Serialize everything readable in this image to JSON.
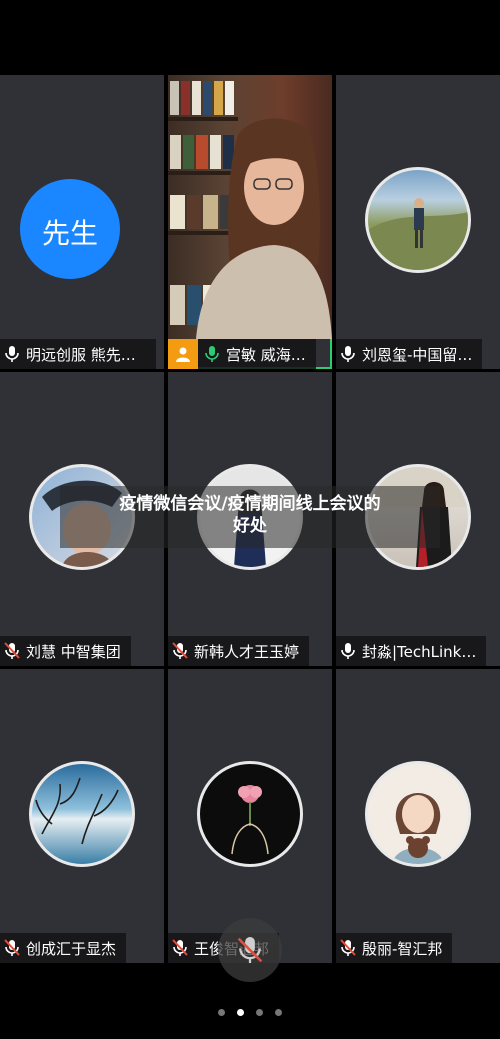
{
  "meeting": {
    "title_line1": "疫情微信会议/疫情期间线上会议的",
    "title_line2": "好处"
  },
  "participants": [
    {
      "name": "明远创服  熊先生…",
      "avatar_text": "先生",
      "mic": "on",
      "avatar": "blue-text"
    },
    {
      "name": "宫敏 威海…",
      "mic": "on",
      "host": true,
      "video": true
    },
    {
      "name": "刘恩玺-中国留…",
      "mic": "on",
      "avatar": "photo-hiker"
    },
    {
      "name": "刘慧 中智集团",
      "mic": "muted",
      "avatar": "photo-woman-hat"
    },
    {
      "name": "新韩人才王玉婷",
      "mic": "muted",
      "avatar": "photo-woman-stage"
    },
    {
      "name": "封淼|TechLink…",
      "mic": "on",
      "avatar": "photo-woman-street"
    },
    {
      "name": "创成汇于显杰",
      "mic": "muted",
      "avatar": "photo-lake"
    },
    {
      "name": "王俊智汇邦",
      "mic": "muted",
      "avatar": "photo-lotus"
    },
    {
      "name": "殷丽-智汇邦",
      "mic": "muted",
      "avatar": "photo-illustration"
    }
  ],
  "pager": {
    "pages": 4,
    "current": 2
  },
  "colors": {
    "accent_green": "#2ecc71",
    "blue_avatar": "#1a86ff",
    "host_badge": "#f39c12",
    "mute_red": "#e74c3c"
  }
}
